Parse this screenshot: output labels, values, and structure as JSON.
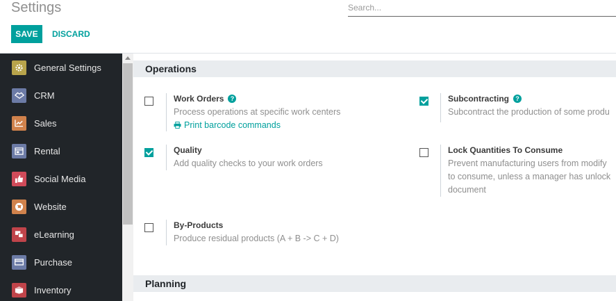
{
  "header": {
    "title": "Settings",
    "search_placeholder": "Search...",
    "save_label": "SAVE",
    "discard_label": "DISCARD"
  },
  "sidebar": {
    "items": [
      {
        "label": "General Settings",
        "icon": "gear-icon",
        "color": "#b8a44b"
      },
      {
        "label": "CRM",
        "icon": "handshake-icon",
        "color": "#6c7ba6"
      },
      {
        "label": "Sales",
        "icon": "chart-icon",
        "color": "#d0824c"
      },
      {
        "label": "Rental",
        "icon": "rental-icon",
        "color": "#6c7ba6"
      },
      {
        "label": "Social Media",
        "icon": "thumbs-up-icon",
        "color": "#d04b5a"
      },
      {
        "label": "Website",
        "icon": "globe-icon",
        "color": "#d0824c"
      },
      {
        "label": "eLearning",
        "icon": "elearning-icon",
        "color": "#c0444a"
      },
      {
        "label": "Purchase",
        "icon": "card-icon",
        "color": "#6c7ba6"
      },
      {
        "label": "Inventory",
        "icon": "box-icon",
        "color": "#c0444a"
      }
    ]
  },
  "sections": {
    "operations": {
      "title": "Operations",
      "work_orders": {
        "title": "Work Orders",
        "desc": "Process operations at specific work centers",
        "link": "Print barcode commands",
        "checked": false
      },
      "subcontracting": {
        "title": "Subcontracting",
        "desc": "Subcontract the production of some produ",
        "checked": true
      },
      "quality": {
        "title": "Quality",
        "desc": "Add quality checks to your work orders",
        "checked": true
      },
      "lock_quantities": {
        "title": "Lock Quantities To Consume",
        "desc_line1": "Prevent manufacturing users from modify",
        "desc_line2": "to consume, unless a manager has unlock",
        "desc_line3": "document",
        "checked": false
      },
      "by_products": {
        "title": "By-Products",
        "desc": "Produce residual products (A + B -> C + D)",
        "checked": false
      }
    },
    "planning": {
      "title": "Planning"
    }
  },
  "colors": {
    "accent": "#00a09d",
    "sidebar_bg": "#212529",
    "section_bg": "#e9ecef"
  }
}
